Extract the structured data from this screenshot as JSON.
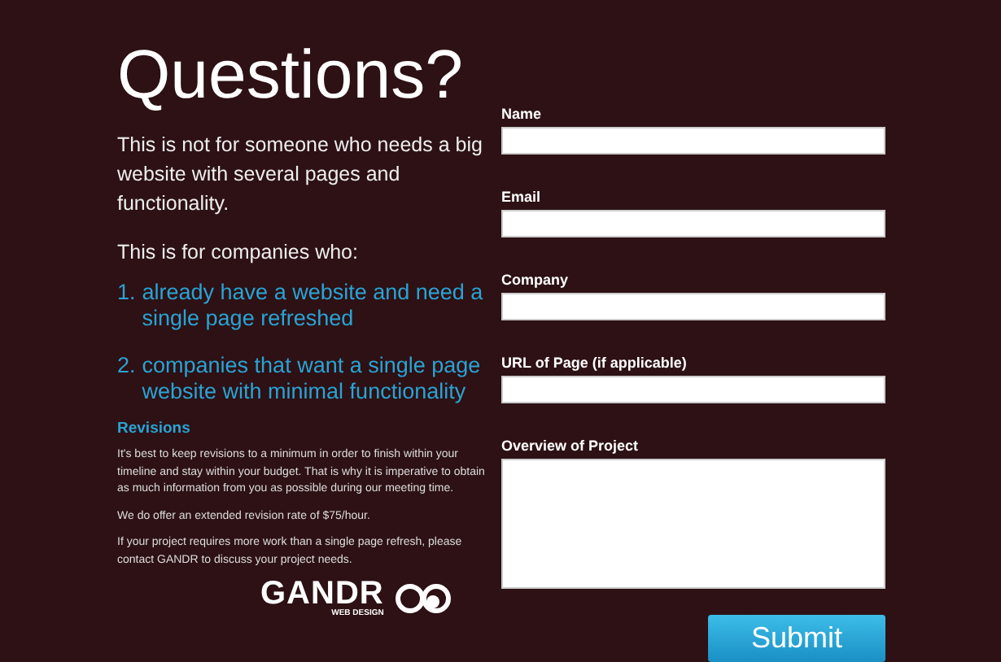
{
  "heading": "Questions?",
  "intro": "This is not for someone who needs a big website with several pages and functionality.",
  "lead": "This is for companies who:",
  "list": [
    {
      "number": "1.",
      "text": "already have a website and need a single page refreshed"
    },
    {
      "number": "2.",
      "text": "companies that want a single page website with minimal functionality"
    }
  ],
  "revisions": {
    "title": "Revisions",
    "paragraphs": [
      "It's best to keep revisions to a minimum in order to finish within your timeline and stay within your budget. That is why it is imperative to obtain as much information from you as possible during our meeting time.",
      "We do offer an extended revision rate of $75/hour.",
      "If your project requires more work than a single page refresh, please contact GANDR to discuss your project needs."
    ]
  },
  "logo": {
    "name": "GANDR",
    "tagline": "WEB DESIGN"
  },
  "form": {
    "fields": [
      {
        "label": "Name",
        "kind": "text"
      },
      {
        "label": "Email",
        "kind": "text"
      },
      {
        "label": "Company",
        "kind": "text"
      },
      {
        "label": "URL of Page (if applicable)",
        "kind": "text"
      },
      {
        "label": "Overview of Project",
        "kind": "textarea"
      }
    ],
    "submit": "Submit"
  }
}
